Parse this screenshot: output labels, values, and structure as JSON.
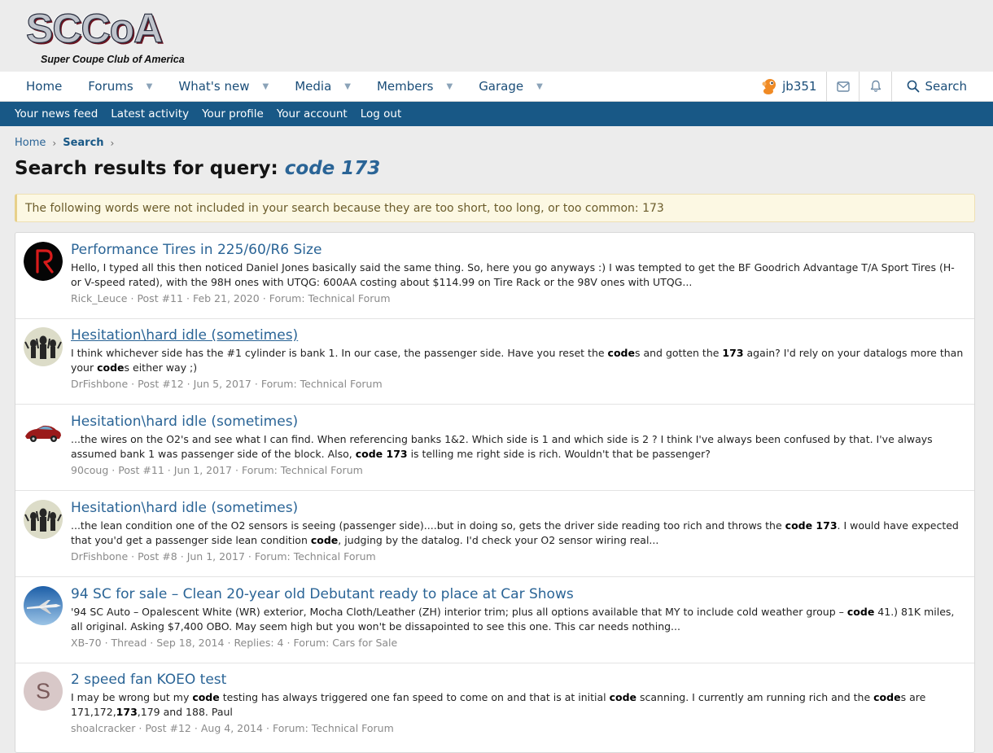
{
  "header": {
    "logo_text": "SCCoA",
    "logo_subtitle": "Super Coupe Club of America"
  },
  "nav": {
    "tabs": [
      {
        "label": "Home",
        "has_menu": false
      },
      {
        "label": "Forums",
        "has_menu": true
      },
      {
        "label": "What's new",
        "has_menu": true
      },
      {
        "label": "Media",
        "has_menu": true
      },
      {
        "label": "Members",
        "has_menu": true
      },
      {
        "label": "Garage",
        "has_menu": true
      }
    ],
    "username": "jb351",
    "search_label": "Search",
    "icons": [
      "inbox-icon",
      "bell-icon",
      "search-icon"
    ]
  },
  "subnav": [
    "Your news feed",
    "Latest activity",
    "Your profile",
    "Your account",
    "Log out"
  ],
  "breadcrumb": [
    "Home",
    "Search"
  ],
  "page_title_prefix": "Search results for query: ",
  "page_title_query": "code 173",
  "notice": "The following words were not included in your search because they are too short, too long, or too common: 173",
  "results": [
    {
      "title": "Performance Tires in 225/60/R6 Size",
      "snippet": [
        {
          "t": "Hello, I typed all this then noticed Daniel Jones basically said the same thing. So, here you go anyways :) I was tempted to get the BF Goodrich Advantage T/A Sport Tires (H- or V-speed rated), with the 98H ones with UTQG: 600AA costing about $114.99 on Tire Rack or the 98V ones with UTQG...",
          "b": false
        }
      ],
      "meta": [
        "Rick_Leuce",
        "Post #11",
        "Feb 21, 2020",
        "Forum: Technical Forum"
      ],
      "avatar": "r-logo"
    },
    {
      "title": "Hesitation\\hard idle (sometimes)",
      "underline": true,
      "snippet": [
        {
          "t": "I think whichever side has the #1 cylinder is bank 1. In our case, the passenger side. Have you reset the ",
          "b": false
        },
        {
          "t": "code",
          "b": true
        },
        {
          "t": "s and gotten the ",
          "b": false
        },
        {
          "t": "173",
          "b": true
        },
        {
          "t": " again? I'd rely on your datalogs more than your ",
          "b": false
        },
        {
          "t": "code",
          "b": true
        },
        {
          "t": "s either way ;)",
          "b": false
        }
      ],
      "meta": [
        "DrFishbone",
        "Post #12",
        "Jun 5, 2017",
        "Forum: Technical Forum"
      ],
      "avatar": "figures"
    },
    {
      "title": "Hesitation\\hard idle (sometimes)",
      "snippet": [
        {
          "t": "...the wires on the O2's and see what I can find. When referencing banks 1&2. Which side is 1 and which side is 2 ? I think I've always been confused by that. I've always assumed bank 1 was passenger side of the block. Also, ",
          "b": false
        },
        {
          "t": "code 173",
          "b": true
        },
        {
          "t": " is telling me right side is rich. Wouldn't that be passenger?",
          "b": false
        }
      ],
      "meta": [
        "90coug",
        "Post #11",
        "Jun 1, 2017",
        "Forum: Technical Forum"
      ],
      "avatar": "car"
    },
    {
      "title": "Hesitation\\hard idle (sometimes)",
      "snippet": [
        {
          "t": "...the lean condition one of the O2 sensors is seeing (passenger side)....but in doing so, gets the driver side reading too rich and throws the ",
          "b": false
        },
        {
          "t": "code 173",
          "b": true
        },
        {
          "t": ". I would have expected that you'd get a passenger side lean condition ",
          "b": false
        },
        {
          "t": "code",
          "b": true
        },
        {
          "t": ", judging by the datalog. I'd check your O2 sensor wiring real...",
          "b": false
        }
      ],
      "meta": [
        "DrFishbone",
        "Post #8",
        "Jun 1, 2017",
        "Forum: Technical Forum"
      ],
      "avatar": "figures"
    },
    {
      "title": "94 SC for sale – Clean 20-year old Debutant ready to place at Car Shows",
      "snippet": [
        {
          "t": "'94 SC Auto – Opalescent White (WR) exterior, Mocha Cloth/Leather (ZH) interior trim; plus all options available that MY to include cold weather group – ",
          "b": false
        },
        {
          "t": "code",
          "b": true
        },
        {
          "t": " 41.) 81K miles, all original. Asking $7,400 OBO. May seem high but you won't be dissapointed to see this one. This car needs nothing...",
          "b": false
        }
      ],
      "meta": [
        "XB-70",
        "Thread",
        "Sep 18, 2014",
        "Replies: 4",
        "Forum: Cars for Sale"
      ],
      "avatar": "jet"
    },
    {
      "title": "2 speed fan KOEO test",
      "snippet": [
        {
          "t": "I may be wrong but my ",
          "b": false
        },
        {
          "t": "code",
          "b": true
        },
        {
          "t": " testing has always triggered one fan speed to come on and that is at initial ",
          "b": false
        },
        {
          "t": "code",
          "b": true
        },
        {
          "t": " scanning. I currently am running rich and the ",
          "b": false
        },
        {
          "t": "code",
          "b": true
        },
        {
          "t": "s are 171,172,",
          "b": false
        },
        {
          "t": "173",
          "b": true
        },
        {
          "t": ",179 and 188. Paul",
          "b": false
        }
      ],
      "meta": [
        "shoalcracker",
        "Post #12",
        "Aug 4, 2014",
        "Forum: Technical Forum"
      ],
      "avatar": "letter",
      "avatar_letter": "S"
    }
  ],
  "colors": {
    "accent": "#185886",
    "link": "#2a6496",
    "notice_bg": "#fcf8e3"
  }
}
